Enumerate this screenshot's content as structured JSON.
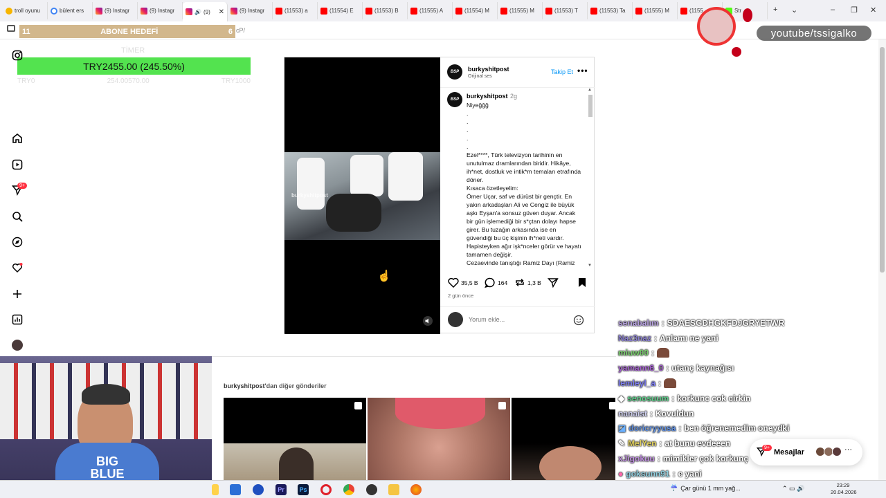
{
  "browser": {
    "tabs": [
      {
        "title": "troll oyunu",
        "icon": "trollface-icon"
      },
      {
        "title": "bülent ers",
        "icon": "google-icon"
      },
      {
        "title": "(9) Instagr",
        "icon": "instagram-icon"
      },
      {
        "title": "(9) Instagr",
        "icon": "instagram-icon"
      },
      {
        "title": "(9)",
        "icon": "instagram-icon",
        "active": true
      },
      {
        "title": "(9) Instagr",
        "icon": "instagram-icon"
      },
      {
        "title": "(11553) a",
        "icon": "youtube-icon"
      },
      {
        "title": "(11554) E",
        "icon": "youtube-icon"
      },
      {
        "title": "(11553) B",
        "icon": "youtube-icon"
      },
      {
        "title": "(11555) A",
        "icon": "youtube-icon"
      },
      {
        "title": "(11554) M",
        "icon": "youtube-icon"
      },
      {
        "title": "(11555) M",
        "icon": "youtube-icon"
      },
      {
        "title": "(11553) T",
        "icon": "youtube-icon"
      },
      {
        "title": "(11553) Ta",
        "icon": "youtube-icon"
      },
      {
        "title": "(11555) M",
        "icon": "youtube-icon"
      },
      {
        "title": "(1155",
        "icon": "youtube-icon"
      },
      {
        "title": "Str",
        "icon": "stream-icon"
      }
    ],
    "url_fragment": "cP/"
  },
  "overlay": {
    "goal_left": "11",
    "goal_label": "ABONE HEDEFİ",
    "goal_right": "6",
    "donation": "TRY2455.00 (245.50%)",
    "donation_sub": "TİMER",
    "donation_left": "TRY0",
    "donation_mid": "254.00570.00",
    "donation_right": "TRY1000"
  },
  "post": {
    "username": "burkyshitpost",
    "audio": "Orijinal ses",
    "follow": "Takip Et",
    "avatar_text": "BSP",
    "watermark": "burkyshitpost",
    "caption_user": "burkyshitpost",
    "caption_time": "2g",
    "caption_text": "Niyeğğğ\n.\n.\n.\n.\n.\nEzel****, Türk televizyon tarihinin en unutulmaz dramlarından biridir. Hikâye, ih*net, dostluk ve intik*m temaları etrafında döner.\nKısaca özetleyelim:\nÖmer Uçar, saf ve dürüst bir gençtir. En yakın arkadaşları Ali ve Cengiz ile büyük aşkı Eyşan'a sonsuz güven duyar. Ancak bir gün işlemediği bir s*çtan dolayı hapse girer. Bu tuzağın arkasında ise en güvendiği bu üç kişinin ih*neti vardır. Hapisteyken ağır işk*nceler görür ve hayatı tamamen değişir.\nCezaevinde tanıştığı Ramiz Dayı (Ramiz Karaeski) sayesinde hayatta kalmayı ve",
    "likes": "35,5 B",
    "comments": "164",
    "reposts": "1,3 B",
    "ago": "2 gün önce",
    "comment_placeholder": "Yorum ekle...",
    "more_label_user": "burkyshitpost",
    "more_label_rest": "'dan diğer gönderiler"
  },
  "stream": {
    "channel": "youtube/tssigalko",
    "shirt_text": "BIG\nBLUE"
  },
  "chat": [
    {
      "user": "senabalım",
      "text": "SDAESGDHGKFDJGRYETWR",
      "color": "#b9a3e3"
    },
    {
      "user": "Naz3naz",
      "text": "Anlamı ne yani",
      "color": "#8a7fd0"
    },
    {
      "user": "miuw00",
      "text": "",
      "color": "#7bd06f",
      "emote": true
    },
    {
      "user": "yamann6_0",
      "text": "utanç kaynağısı",
      "color": "#a45fd0"
    },
    {
      "user": "lemleyl_a",
      "text": "",
      "color": "#7d7df0",
      "emote": true
    },
    {
      "user": "senosuum",
      "text": "korkunc cok cirkin",
      "color": "#5fd08c"
    },
    {
      "user": "nanaist",
      "text": "Kovuldun",
      "color": "#cfd0f0"
    },
    {
      "user": "doricryyusa",
      "text": "ben öğrenemedim oneydki",
      "color": "#5f8fe0"
    },
    {
      "user": "MelYen",
      "text": "at bunu evdeeen",
      "color": "#e0d05f"
    },
    {
      "user": "xJigokuu",
      "text": "mimikler çok korkunç",
      "color": "#c08fe0"
    },
    {
      "user": "goksunn91",
      "text": "e yani",
      "color": "#8fd0e0"
    }
  ],
  "messages": {
    "label": "Mesajlar",
    "badge": "9+"
  },
  "sidebar_badge": "9+",
  "taskbar": {
    "weather": "Çar günü 1 mm yağ...",
    "time": "23:29",
    "date": "20.04.2026"
  },
  "colors": {
    "link_blue": "#0095f6",
    "donation_green": "#53e34f",
    "goal_tan": "#d2b78c",
    "badge_red": "#ff3040"
  }
}
